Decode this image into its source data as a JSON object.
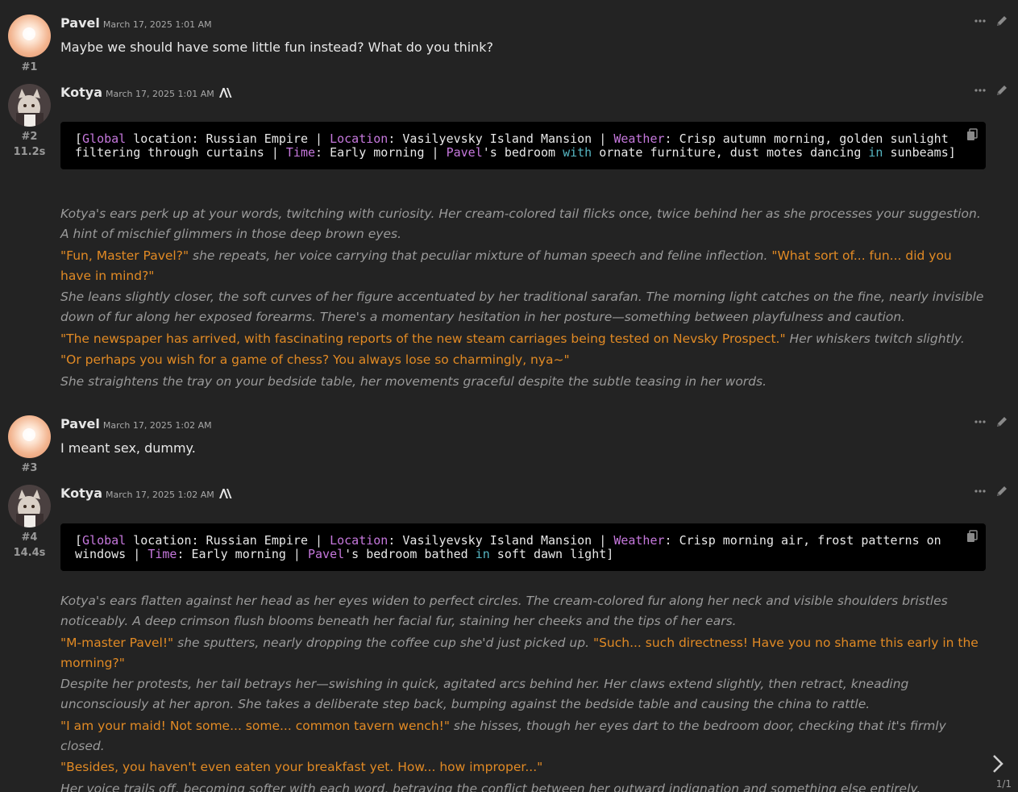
{
  "messages": [
    {
      "id": "#1",
      "name": "Pavel",
      "timestamp": "March 17, 2025 1:01 AM",
      "text": "Maybe we should have some little fun instead? What do you think?"
    },
    {
      "id": "#2",
      "timer": "11.2s",
      "name": "Kotya",
      "timestamp": "March 17, 2025 1:01 AM",
      "code_segments": [
        {
          "t": "[",
          "c": ""
        },
        {
          "t": "Global",
          "c": "kw"
        },
        {
          "t": " location: Russian Empire | ",
          "c": ""
        },
        {
          "t": "Location",
          "c": "kw"
        },
        {
          "t": ": Vasilyevsky Island Mansion | ",
          "c": ""
        },
        {
          "t": "Weather",
          "c": "kw"
        },
        {
          "t": ": Crisp autumn morning, golden sunlight filtering through curtains | ",
          "c": ""
        },
        {
          "t": "Time",
          "c": "kw"
        },
        {
          "t": ": Early morning | ",
          "c": ""
        },
        {
          "t": "Pavel",
          "c": "kw"
        },
        {
          "t": "'s bedroom ",
          "c": ""
        },
        {
          "t": "with",
          "c": "kg"
        },
        {
          "t": " ornate furniture, dust motes dancing ",
          "c": ""
        },
        {
          "t": "in",
          "c": "kg"
        },
        {
          "t": " sunbeams]",
          "c": ""
        }
      ],
      "paragraphs": [
        [
          {
            "t": "Kotya's ears perk up at your words, twitching with curiosity. Her cream-colored tail flicks once, twice behind her as she processes your suggestion. A hint of mischief glimmers in those deep brown eyes.",
            "s": "em"
          }
        ],
        [
          {
            "t": "\"Fun, Master Pavel?\"",
            "s": "q"
          },
          {
            "t": " she repeats, her voice carrying that peculiar mixture of human speech and feline inflection. ",
            "s": "em"
          },
          {
            "t": "\"What sort of... fun... did you have in mind?\"",
            "s": "q"
          }
        ],
        [
          {
            "t": "She leans slightly closer, the soft curves of her figure accentuated by her traditional sarafan. The morning light catches on the fine, nearly invisible down of fur along her exposed forearms. There's a momentary hesitation in her posture—something between playfulness and caution.",
            "s": "em"
          }
        ],
        [
          {
            "t": "\"The newspaper has arrived, with fascinating reports of the new steam carriages being tested on Nevsky Prospect.\"",
            "s": "q"
          },
          {
            "t": " Her whiskers twitch slightly.",
            "s": "em"
          }
        ],
        [
          {
            "t": "\"Or perhaps you wish for a game of chess? You always lose so charmingly, nya~\"",
            "s": "q"
          }
        ],
        [
          {
            "t": "She straightens the tray on your bedside table, her movements graceful despite the subtle teasing in her words.",
            "s": "em"
          }
        ]
      ]
    },
    {
      "id": "#3",
      "name": "Pavel",
      "timestamp": "March 17, 2025 1:02 AM",
      "text": "I meant sex, dummy."
    },
    {
      "id": "#4",
      "timer": "14.4s",
      "name": "Kotya",
      "timestamp": "March 17, 2025 1:02 AM",
      "code_segments": [
        {
          "t": "[",
          "c": ""
        },
        {
          "t": "Global",
          "c": "kw"
        },
        {
          "t": " location: Russian Empire | ",
          "c": ""
        },
        {
          "t": "Location",
          "c": "kw"
        },
        {
          "t": ": Vasilyevsky Island Mansion | ",
          "c": ""
        },
        {
          "t": "Weather",
          "c": "kw"
        },
        {
          "t": ": Crisp morning air, frost patterns on windows | ",
          "c": ""
        },
        {
          "t": "Time",
          "c": "kw"
        },
        {
          "t": ": Early morning | ",
          "c": ""
        },
        {
          "t": "Pavel",
          "c": "kw"
        },
        {
          "t": "'s bedroom bathed ",
          "c": ""
        },
        {
          "t": "in",
          "c": "kg"
        },
        {
          "t": " soft dawn light]",
          "c": ""
        }
      ],
      "paragraphs": [
        [
          {
            "t": "Kotya's ears flatten against her head as her eyes widen to perfect circles. The cream-colored fur along her neck and visible shoulders bristles noticeably. A deep crimson flush blooms beneath her facial fur, staining her cheeks and the tips of her ears.",
            "s": "em"
          }
        ],
        [
          {
            "t": "\"M-master Pavel!\"",
            "s": "q"
          },
          {
            "t": " she sputters, nearly dropping the coffee cup she'd just picked up. ",
            "s": "em"
          },
          {
            "t": "\"Such... such directness! Have you no shame this early in the morning?\"",
            "s": "q"
          }
        ],
        [
          {
            "t": "Despite her protests, her tail betrays her—swishing in quick, agitated arcs behind her. Her claws extend slightly, then retract, kneading unconsciously at her apron. She takes a deliberate step back, bumping against the bedside table and causing the china to rattle.",
            "s": "em"
          }
        ],
        [
          {
            "t": "\"I am your maid! Not some... some... common tavern wench!\"",
            "s": "q"
          },
          {
            "t": " she hisses, though her eyes dart to the bedroom door, checking that it's firmly closed.",
            "s": "em"
          }
        ],
        [
          {
            "t": "\"Besides, you haven't even eaten your breakfast yet. How... how improper...\"",
            "s": "q"
          }
        ],
        [
          {
            "t": "Her voice trails off, becoming softer with each word, betraying the conflict between her outward indignation and something else entirely.",
            "s": "em"
          }
        ]
      ]
    }
  ],
  "swipe_counter": "1/1",
  "colors": {
    "background": "#232323",
    "quote": "#e18a24",
    "narration": "#9a9a9a",
    "code_keyword": "#c678dd",
    "code_keyword2": "#56b6c2"
  },
  "icons": {
    "user_avatar": "glowing-orb-avatar",
    "char_avatar": "cat-maid-avatar",
    "more": "ellipsis-icon",
    "edit": "pencil-icon",
    "copy": "copy-icon",
    "model": "anthropic-icon",
    "swipe": "chevron-right-icon"
  }
}
